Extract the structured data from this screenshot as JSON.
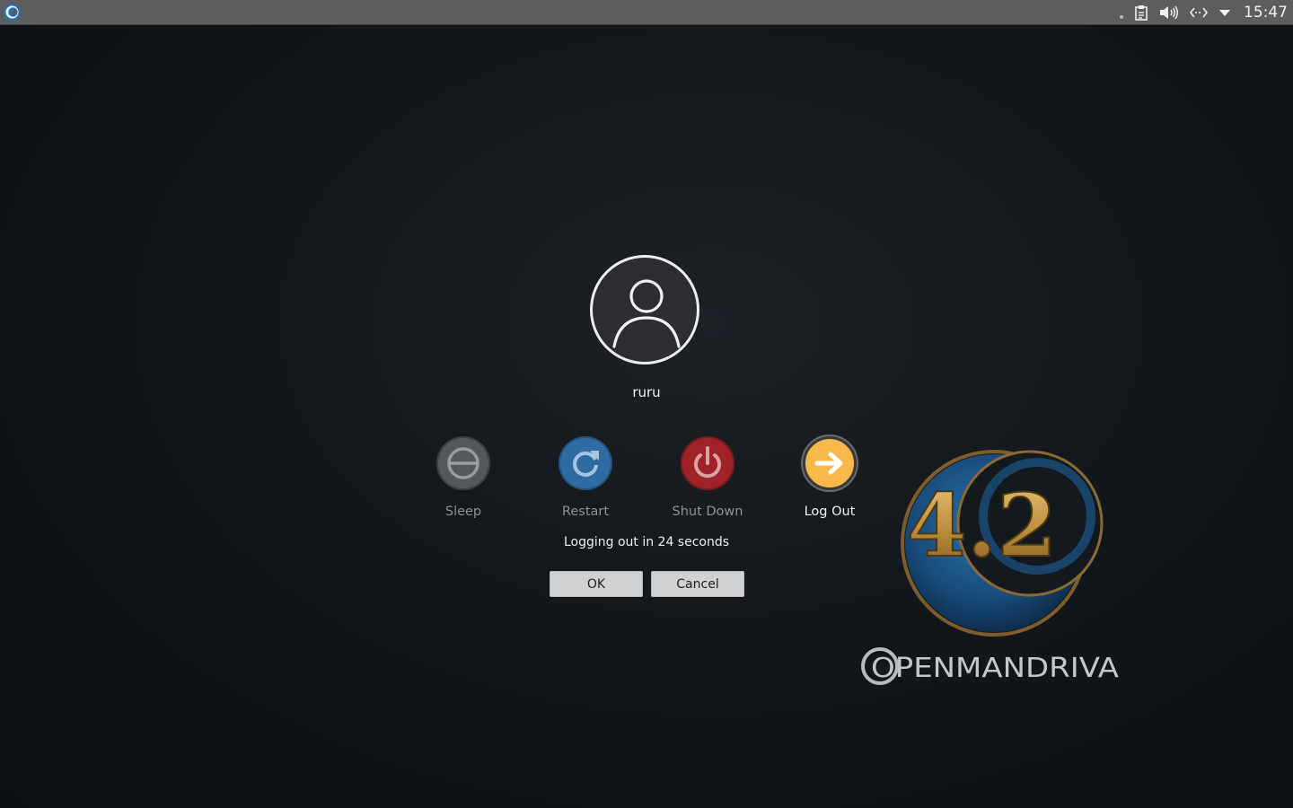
{
  "topbar": {
    "launcher_icon": "openmandriva-launcher-icon",
    "tray_icons": [
      "notification-dot-icon",
      "clipboard-icon",
      "volume-icon",
      "network-icon",
      "tray-expand-arrow-icon"
    ],
    "clock": "15:47"
  },
  "user": {
    "avatar_icon": "user-avatar-icon",
    "name": "ruru"
  },
  "actions": [
    {
      "label": "Sleep",
      "icon": "sleep-icon",
      "color": "#55585c"
    },
    {
      "label": "Restart",
      "icon": "restart-icon",
      "color": "#2f6aa3"
    },
    {
      "label": "Shut Down",
      "icon": "power-icon",
      "color": "#9e2227"
    },
    {
      "label": "Log Out",
      "icon": "logout-arrow-icon",
      "color": "#f9b94a",
      "selected": true
    }
  ],
  "status_text": "Logging out in 24 seconds",
  "buttons": {
    "ok": "OK",
    "cancel": "Cancel"
  },
  "branding": {
    "version": "4.2",
    "name": "OPENMANDRIVA"
  },
  "colors": {
    "panel": "#5b5d5f",
    "accent_gold": "#c79a4a",
    "accent_blue": "#1f5e93"
  }
}
